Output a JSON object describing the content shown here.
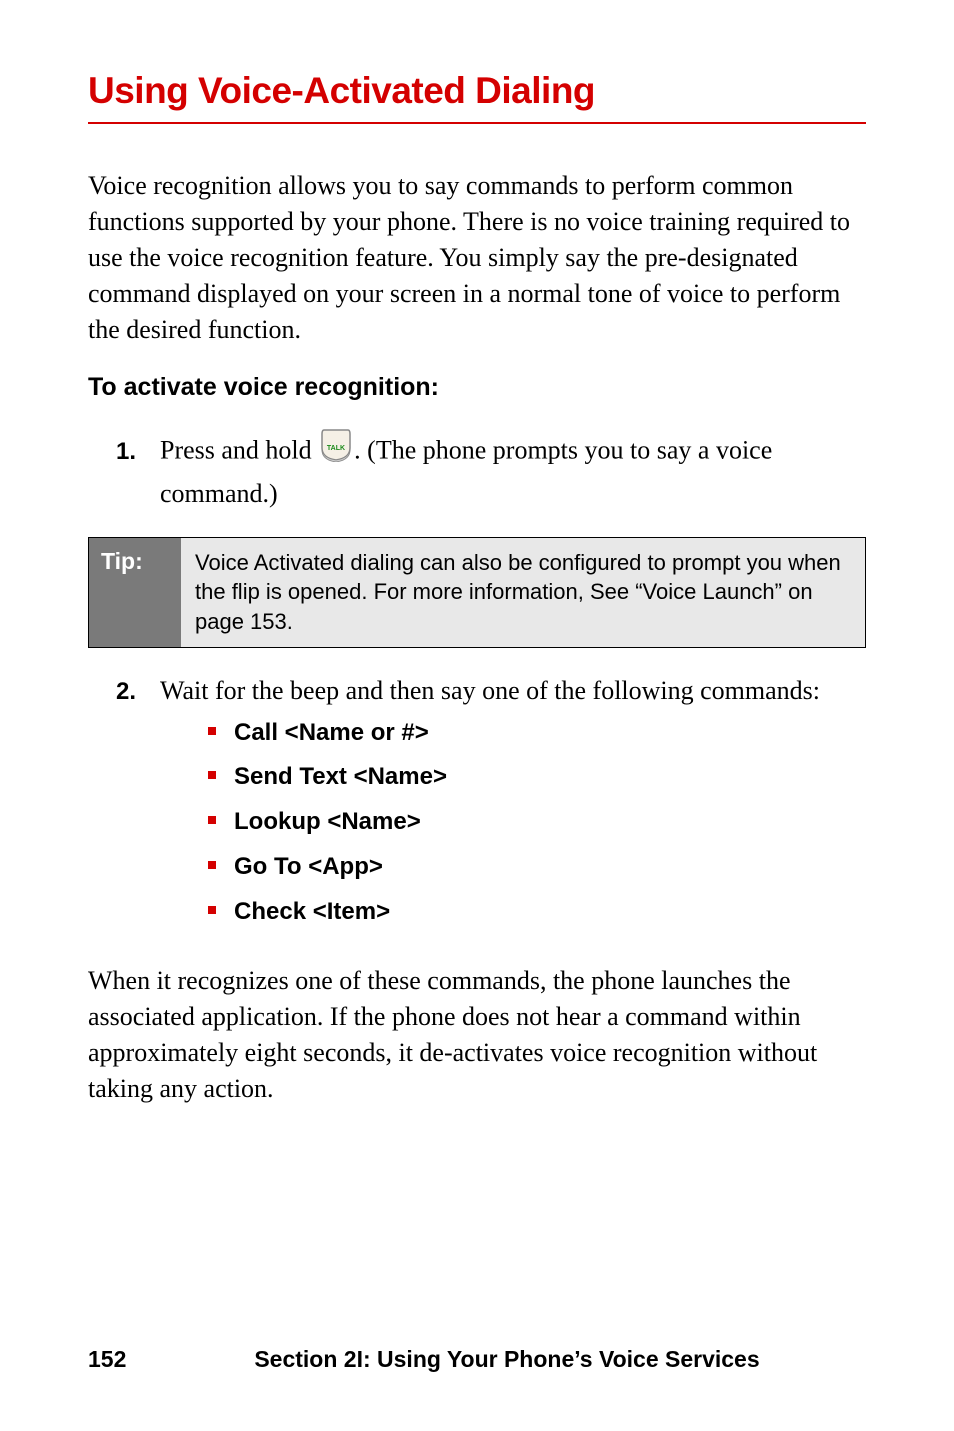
{
  "title": "Using Voice-Activated Dialing",
  "intro": "Voice recognition allows you to say commands to perform common functions supported by your phone. There is no voice training required to use the voice recognition feature. You simply say the pre-designated command displayed on your screen in a normal tone of voice to perform the desired function.",
  "subhead": "To activate voice recognition:",
  "step1_num": "1.",
  "step1_before": "Press and hold ",
  "step1_after": ". (The phone prompts you to say a voice command.)",
  "key_label": "TALK",
  "tip_label": "Tip:",
  "tip_content": "Voice Activated dialing can also be configured to prompt you when the flip is opened. For more information, See “Voice Launch” on page 153.",
  "step2_num": "2.",
  "step2_text": "Wait for the beep and then say one of the following commands:",
  "commands": [
    "Call <Name or #>",
    "Send Text <Name>",
    "Lookup <Name>",
    "Go To <App>",
    "Check <Item>"
  ],
  "closing": "When it recognizes one of these commands, the phone launches the associated application. If the phone does not hear a command within approximately eight seconds, it de-activates voice recognition without taking any action.",
  "footer_page": "152",
  "footer_section": "Section 2I: Using Your Phone’s Voice Services"
}
